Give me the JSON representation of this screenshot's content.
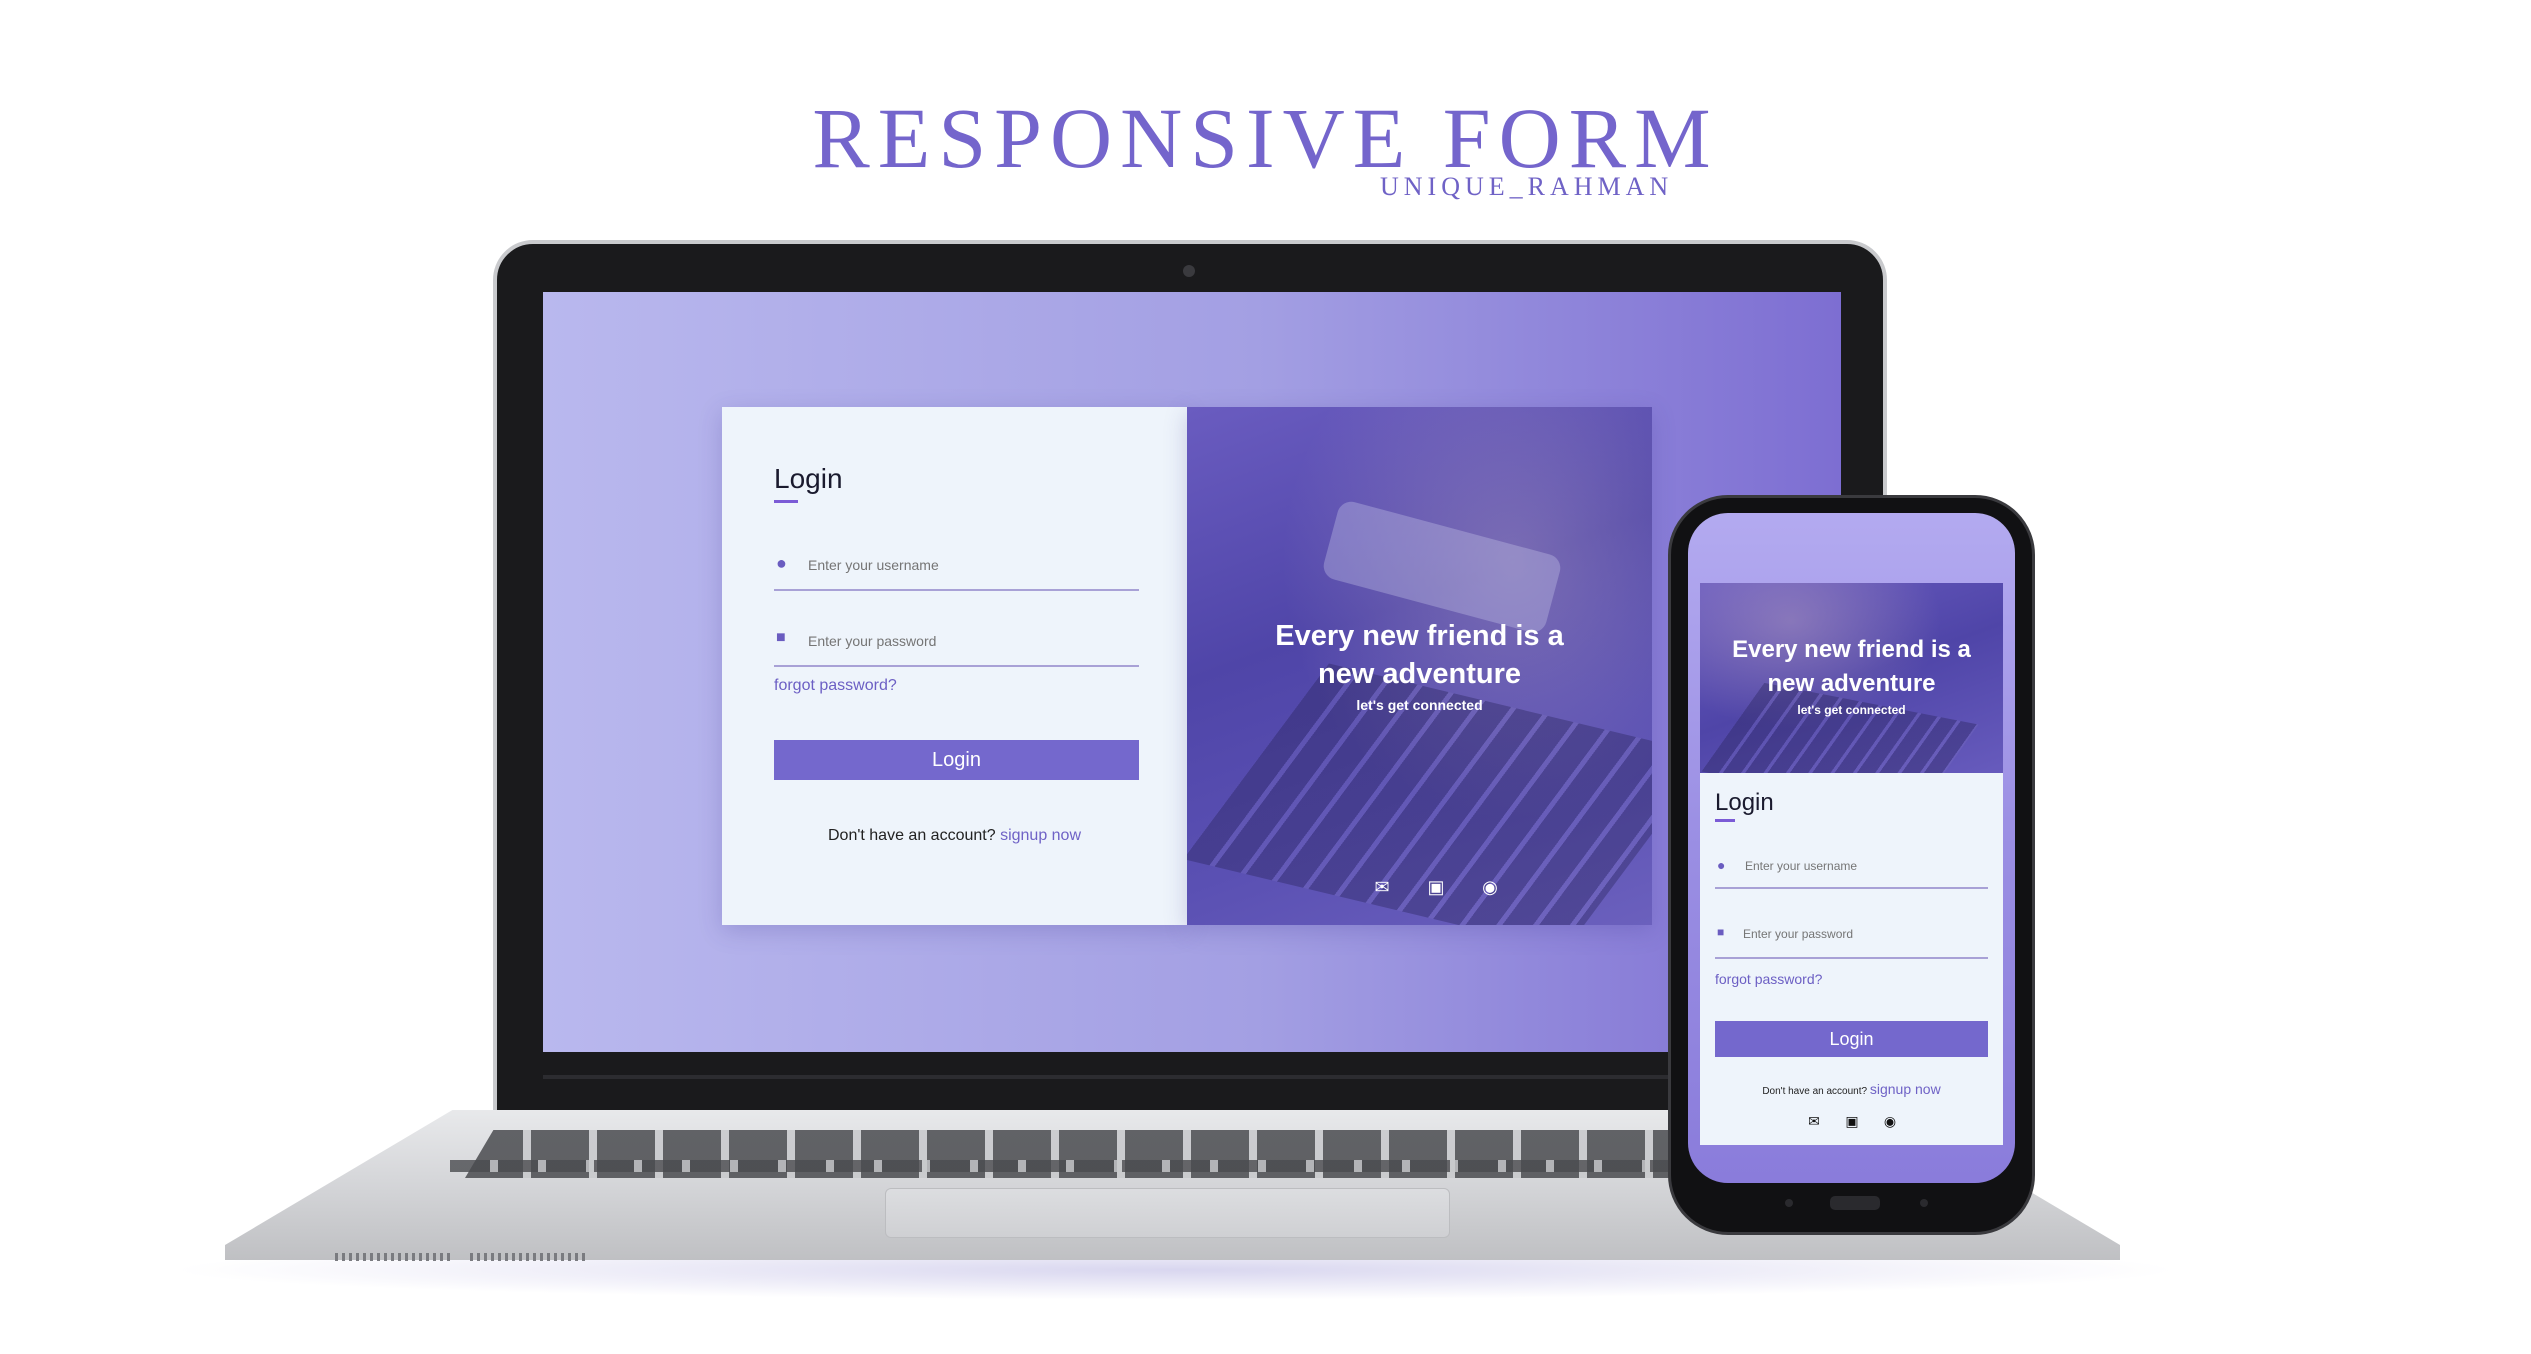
{
  "header": {
    "title": "RESPONSIVE FORM",
    "author": "UNIQUE_RAHMAN"
  },
  "laptop_form": {
    "login_title": "Login",
    "username_placeholder": "Enter your username",
    "password_placeholder": "Enter your password",
    "forgot_password": "forgot password?",
    "login_button": "Login",
    "signup_prompt": "Don't have an account?",
    "signup_link": "signup now",
    "hero_headline_line1": "Every new friend is a",
    "hero_headline_line2": "new adventure",
    "hero_sub": "let's get connected",
    "social_icons": [
      "envelope-icon",
      "linkedin-icon",
      "instagram-icon"
    ]
  },
  "phone_form": {
    "hero_headline_line1": "Every new friend is a",
    "hero_headline_line2": "new adventure",
    "hero_sub": "let's get connected",
    "login_title": "Login",
    "username_placeholder": "Enter your username",
    "password_placeholder": "Enter your password",
    "forgot_password": "forgot password?",
    "login_button": "Login",
    "signup_prompt": "Don't have an account?",
    "signup_link": "signup now",
    "social_icons": [
      "envelope-icon",
      "linkedin-icon",
      "instagram-icon"
    ]
  },
  "colors": {
    "accent": "#7468cd",
    "title": "#7465cc",
    "card_background": "#eef4fb"
  }
}
